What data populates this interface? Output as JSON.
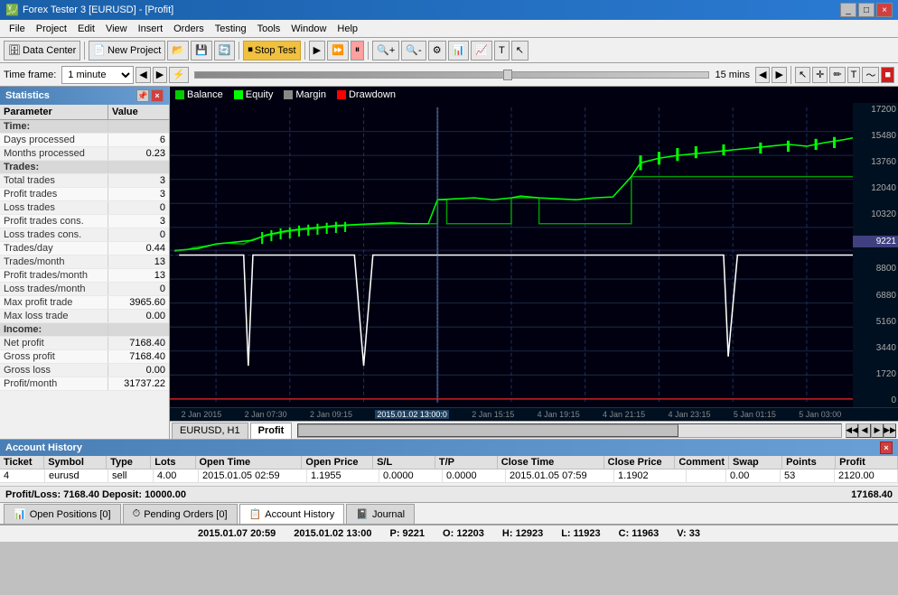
{
  "titlebar": {
    "title": "Forex Tester 3 [EURUSD] - [Profit]",
    "controls": [
      "_",
      "□",
      "×"
    ]
  },
  "menubar": {
    "items": [
      "File",
      "Project",
      "Edit",
      "View",
      "Insert",
      "Orders",
      "Testing",
      "Tools",
      "Window",
      "Help"
    ]
  },
  "toolbar": {
    "datacenter_label": "Data Center",
    "newproject_label": "New Project",
    "stoptest_label": "Stop Test"
  },
  "toolbar2": {
    "timeframe_label": "Time frame:",
    "timeframe_value": "1 minute",
    "interval_value": "15 mins"
  },
  "stats": {
    "title": "Statistics",
    "col_param": "Parameter",
    "col_value": "Value",
    "rows": [
      {
        "param": "Time:",
        "value": "",
        "section": true
      },
      {
        "param": "Days processed",
        "value": "6"
      },
      {
        "param": "Months processed",
        "value": "0.23"
      },
      {
        "param": "Trades:",
        "value": "",
        "section": true
      },
      {
        "param": "Total trades",
        "value": "3"
      },
      {
        "param": "Profit trades",
        "value": "3"
      },
      {
        "param": "Loss trades",
        "value": "0"
      },
      {
        "param": "Profit trades cons.",
        "value": "3"
      },
      {
        "param": "Loss trades cons.",
        "value": "0"
      },
      {
        "param": "Trades/day",
        "value": "0.44"
      },
      {
        "param": "Trades/month",
        "value": "13"
      },
      {
        "param": "Profit trades/month",
        "value": "13"
      },
      {
        "param": "Loss trades/month",
        "value": "0"
      },
      {
        "param": "Max profit trade",
        "value": "3965.60"
      },
      {
        "param": "Max loss trade",
        "value": "0.00"
      },
      {
        "param": "Income:",
        "value": "",
        "section": true
      },
      {
        "param": "Net profit",
        "value": "7168.40"
      },
      {
        "param": "Gross profit",
        "value": "7168.40"
      },
      {
        "param": "Gross loss",
        "value": "0.00"
      },
      {
        "param": "Profit/month",
        "value": "31737.22"
      }
    ]
  },
  "chart": {
    "legend": [
      {
        "label": "Balance",
        "color": "#00cc00"
      },
      {
        "label": "Equity",
        "color": "#00ff00"
      },
      {
        "label": "Margin",
        "color": "#888888"
      },
      {
        "label": "Drawdown",
        "color": "#ff0000"
      }
    ],
    "price_labels": [
      "17200",
      "15480",
      "13760",
      "12040",
      "10320",
      "9221",
      "8800",
      "6880",
      "5160",
      "3440",
      "1720",
      "0"
    ],
    "time_labels": [
      "2 Jan 2015",
      "2 Jan 07:30",
      "2 Jan 09:15",
      "2015.01.02 13:00:0",
      "2 Jan 15:15",
      "4 Jan 19:15",
      "4 Jan 21:15",
      "4 Jan 23:15",
      "5 Jan 01:15",
      "5 Jan 03:00"
    ],
    "current_price": "9221",
    "tabs": [
      {
        "label": "EURUSD, H1"
      },
      {
        "label": "Profit",
        "active": true
      }
    ]
  },
  "account_history": {
    "title": "Account History",
    "columns": [
      "Ticket",
      "Symbol",
      "Type",
      "Lots",
      "Open Time",
      "Open Price",
      "S/L",
      "T/P",
      "Close Time",
      "Close Price",
      "Comment",
      "Swap",
      "Points",
      "Profit"
    ],
    "rows": [
      {
        "ticket": "4",
        "symbol": "eurusd",
        "type": "sell",
        "lots": "4.00",
        "open_time": "2015.01.05 02:59",
        "open_price": "1.1955",
        "sl": "0.0000",
        "tp": "0.0000",
        "close_time": "2015.01.05 07:59",
        "close_price": "1.1902",
        "comment": "",
        "swap": "0.00",
        "points": "53",
        "profit": "2120.00"
      }
    ],
    "pl_label": "Profit/Loss:",
    "pl_value": "7168.40",
    "deposit_label": "Deposit:",
    "deposit_value": "10000.00",
    "balance_value": "17168.40"
  },
  "bottom_tabs": [
    {
      "label": "Open Positions [0]",
      "icon": "chart-icon"
    },
    {
      "label": "Pending Orders [0]",
      "icon": "clock-icon"
    },
    {
      "label": "Account History",
      "icon": "list-icon",
      "active": true
    },
    {
      "label": "Journal",
      "icon": "doc-icon"
    }
  ],
  "statusbar": {
    "datetime": "2015.01.07 20:59",
    "chart_time": "2015.01.02 13:00",
    "p_label": "P:",
    "p_value": "9221",
    "o_label": "O:",
    "o_value": "12203",
    "h_label": "H:",
    "h_value": "12923",
    "l_label": "L:",
    "l_value": "11923",
    "c_label": "C:",
    "c_value": "11963",
    "v_label": "V:",
    "v_value": "33"
  }
}
